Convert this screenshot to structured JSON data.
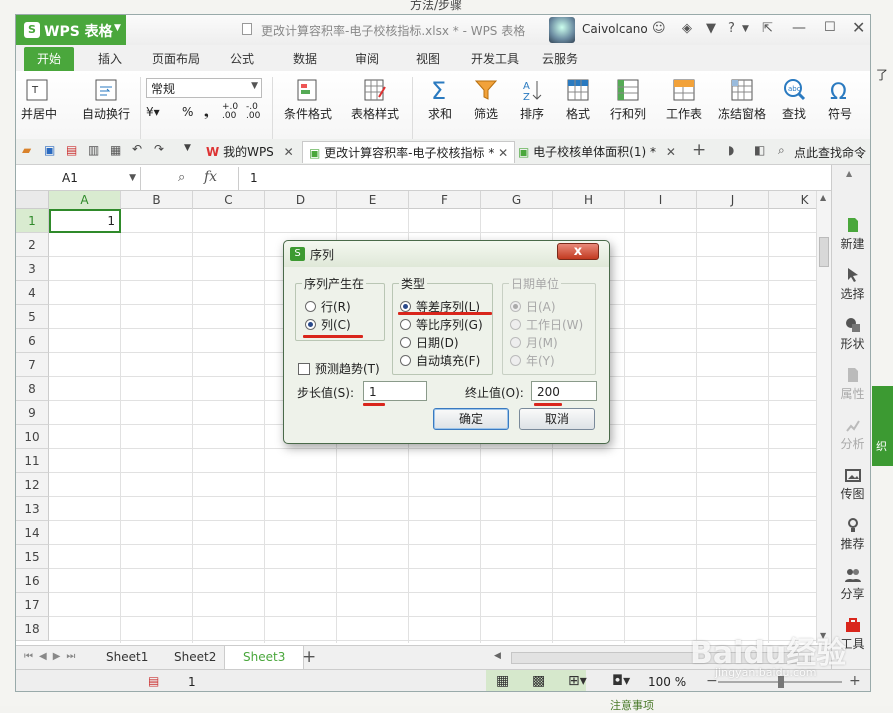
{
  "background_page": {
    "top_text": "方法/步骤",
    "right_text": "了",
    "green_tab_text": "织",
    "bottom_text": "注意事项"
  },
  "titlebar": {
    "app_button": "WPS 表格",
    "document_title": "更改计算容积率-电子校核指标.xlsx * - WPS 表格",
    "username": "Caivolcano"
  },
  "menu_tabs": [
    "开始",
    "插入",
    "页面布局",
    "公式",
    "数据",
    "审阅",
    "视图",
    "开发工具",
    "云服务"
  ],
  "ribbon": {
    "merge_center": "并居中",
    "wrap_text": "自动换行",
    "number_format": "常规",
    "percent": "%",
    "comma": "❟",
    "cond_format": "条件格式",
    "table_style": "表格样式",
    "sum": "求和",
    "filter": "筛选",
    "sort": "排序",
    "format": "格式",
    "rowcol": "行和列",
    "worksheet": "工作表",
    "freeze": "冻结窗格",
    "find": "查找",
    "symbol": "符号"
  },
  "doc_tabs": {
    "mywps": "我的WPS",
    "active": "更改计算容积率-电子校核指标 *",
    "other": "电子校核单体面积(1) *",
    "search": "点此查找命令"
  },
  "formula_bar": {
    "name_box": "A1",
    "fx": "fx",
    "value": "1"
  },
  "grid": {
    "columns": [
      "A",
      "B",
      "C",
      "D",
      "E",
      "F",
      "G",
      "H",
      "I",
      "J",
      "K"
    ],
    "rows": [
      "1",
      "2",
      "3",
      "4",
      "5",
      "6",
      "7",
      "8",
      "9",
      "10",
      "11",
      "12",
      "13",
      "14",
      "15",
      "16",
      "17",
      "18"
    ],
    "cell_a1": "1"
  },
  "sheets": [
    "Sheet1",
    "Sheet2",
    "Sheet3"
  ],
  "status": {
    "value": "1",
    "zoom": "100 %"
  },
  "right_panel": [
    "新建",
    "选择",
    "形状",
    "属性",
    "分析",
    "传图",
    "推荐",
    "分享",
    "工具"
  ],
  "dialog": {
    "title": "序列",
    "close": "x",
    "group_series_in": "序列产生在",
    "opt_row": "行(R)",
    "opt_col": "列(C)",
    "group_type": "类型",
    "opt_linear": "等差序列(L)",
    "opt_growth": "等比序列(G)",
    "opt_date": "日期(D)",
    "opt_autofill": "自动填充(F)",
    "group_date_unit": "日期单位",
    "opt_day": "日(A)",
    "opt_weekday": "工作日(W)",
    "opt_month": "月(M)",
    "opt_year": "年(Y)",
    "trend": "预测趋势(T)",
    "step_label": "步长值(S):",
    "step_value": "1",
    "stop_label": "终止值(O):",
    "stop_value": "200",
    "ok": "确定",
    "cancel": "取消"
  },
  "watermark": {
    "main": "Baidu经验",
    "sub": "jingyan.baidu.com"
  },
  "colors": {
    "brand_green": "#4aa73c",
    "annotation_red": "#d9261c"
  }
}
